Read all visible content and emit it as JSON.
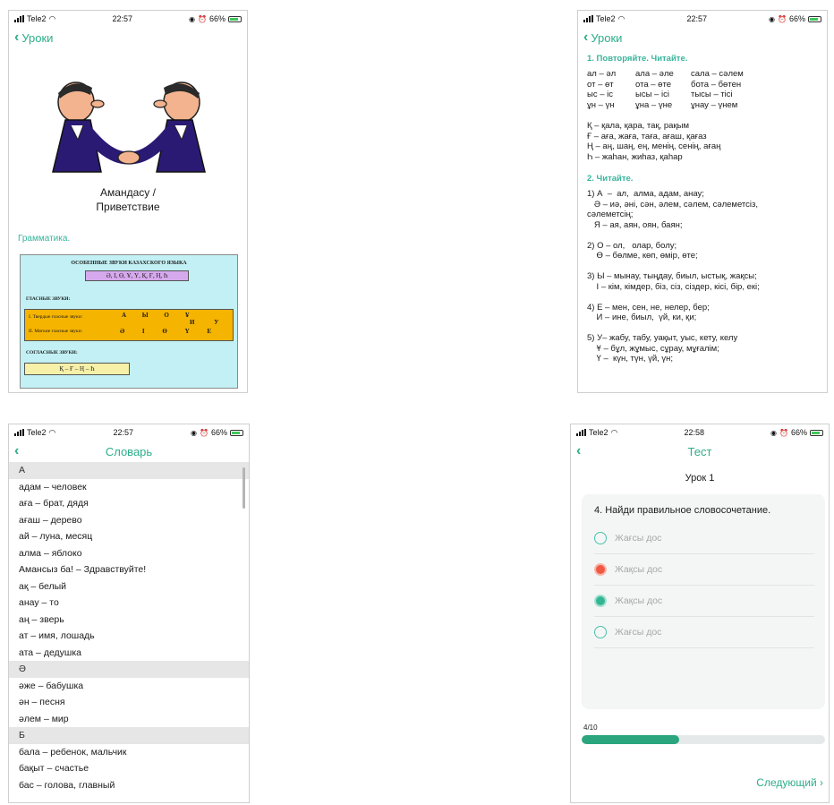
{
  "statusbar": {
    "carrier": "Tele2",
    "battery": "66%",
    "icons": [
      "signal-icon",
      "wifi-icon",
      "location-icon",
      "alarm-icon",
      "battery-icon"
    ],
    "time_a": "22:57",
    "time_b": "22:58"
  },
  "colors": {
    "accent": "#2cae88",
    "section_teal": "#37b49b",
    "wrong": "#ef5944",
    "correct": "#34b694",
    "progress": "#2aa57e"
  },
  "screen1": {
    "back_label": "Уроки",
    "lesson_title": "Амандасу /",
    "lesson_subtitle": "Приветствие",
    "section": "Грамматика.",
    "card": {
      "title": "ОСОБЕННЫЕ ЗВУКИ КАЗАХСКОГО ЯЗЫКА",
      "special_letters": "Ә, І, Ө, Ұ, Ү, Қ, Ғ, Ң, Һ",
      "vowels_label": "ГЛАСНЫЕ ЗВУКИ:",
      "hard_label": "I. Твердые гласные звуки:",
      "hard_letters": "А Ы О Ұ",
      "extra_letters": "И У",
      "soft_label": "II. Мягкие гласные звуки:",
      "soft_letters": "Ә І Ө Ү Е",
      "consonants_label": "СОГЛАСНЫЕ ЗВУКИ:",
      "consonants": "Қ – Ғ – Ң – Һ"
    }
  },
  "screen2": {
    "back_label": "Уроки",
    "heading1": "1. Повторяйте. Читайте.",
    "pairs": [
      [
        "ал – әл",
        "ала – әле",
        "сала – сәлем"
      ],
      [
        "от – өт",
        "ота – өте",
        "бота – бөтен"
      ],
      [
        "ыс – іс",
        "ысы – ісі",
        "тысы – тісі"
      ],
      [
        "ұн – үн",
        "ұна – үне",
        "ұнау – үнем"
      ]
    ],
    "letters": [
      "Қ – қала, қара, тақ, рақым",
      "Ғ – аға, жаға, таға, ағаш, қағаз",
      "Ң – аң, шаң, ең, менің, сенің, ағаң",
      "Һ – жаһан, жиһаз, қаһар"
    ],
    "heading2": "2. Читайте.",
    "exercise": [
      "1) А  –  ал,  алма, адам, анау;",
      "   Ә – иә, әні, сән, әлем, сәлем, сәлеметсіз,",
      "сәлеметсің;",
      "   Я – ая, аян, оян, баян;",
      "",
      "2) О – ол,   олар, болу;",
      "    Ө – бөлме, көп, өмір, өте;",
      "",
      "3) Ы – мынау, тыңдау, биыл, ыстық, жақсы;",
      "    І – кім, кімдер, біз, сіз, сіздер, кісі, бір, екі;",
      "",
      "4) Е – мен, сен, не, нелер, бер;",
      "    И – ине, биыл,  үй, ки, қи;",
      "",
      "5) У– жабу, табу, уақыт, уыс, кету, келу",
      "    Ұ – бұл, жұмыс, сұрау, мұғалім;",
      "    Ү –  күн, түн, үй, үн;"
    ]
  },
  "screen3": {
    "title": "Словарь",
    "rows": [
      {
        "text": "А",
        "header": true
      },
      {
        "text": "адам – человек",
        "header": false
      },
      {
        "text": "аға – брат, дядя",
        "header": false
      },
      {
        "text": "ағаш – дерево",
        "header": false
      },
      {
        "text": "ай – луна, месяц",
        "header": false
      },
      {
        "text": "алма – яблоко",
        "header": false
      },
      {
        "text": "Амансыз ба! – Здравствуйте!",
        "header": false
      },
      {
        "text": "ақ – белый",
        "header": false
      },
      {
        "text": "анау – то",
        "header": false
      },
      {
        "text": "аң – зверь",
        "header": false
      },
      {
        "text": "ат – имя, лошадь",
        "header": false
      },
      {
        "text": "ата – дедушка",
        "header": false
      },
      {
        "text": "Ә",
        "header": true
      },
      {
        "text": "әже – бабушка",
        "header": false
      },
      {
        "text": "ән – песня",
        "header": false
      },
      {
        "text": "әлем – мир",
        "header": false
      },
      {
        "text": "Б",
        "header": true
      },
      {
        "text": "бала – ребенок, мальчик",
        "header": false
      },
      {
        "text": "бақыт – счастье",
        "header": false
      },
      {
        "text": "бас – голова, главный",
        "header": false
      }
    ]
  },
  "screen4": {
    "title": "Тест",
    "lesson": "Урок 1",
    "question": "4. Найди правильное словосочетание.",
    "options": [
      {
        "text": "Жағсы дос",
        "state": "empty"
      },
      {
        "text": "Жақсы дос",
        "state": "wrong"
      },
      {
        "text": "Жақсы дос",
        "state": "correct"
      },
      {
        "text": "Жағсы дос",
        "state": "empty"
      }
    ],
    "progress_label": "4/10",
    "progress_fraction": 0.4,
    "next_label": "Следующий"
  }
}
